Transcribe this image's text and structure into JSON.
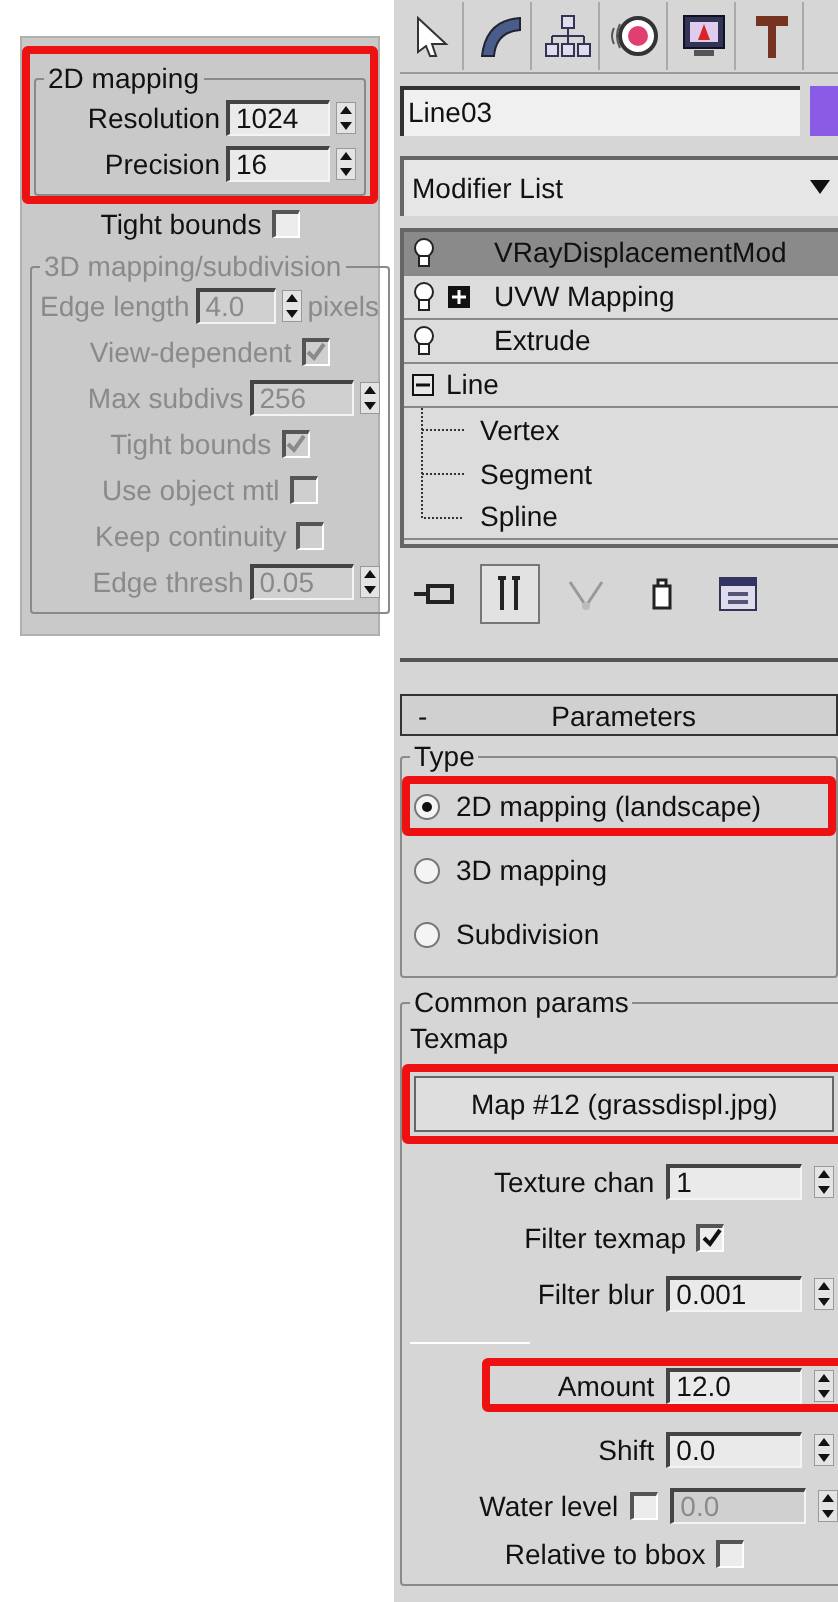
{
  "left_panel": {
    "group_2d": {
      "title": "2D mapping",
      "highlighted": true,
      "rows": [
        {
          "label": "Resolution",
          "value": "1024"
        },
        {
          "label": "Precision",
          "value": "16"
        }
      ]
    },
    "tight_bounds": {
      "label": "Tight bounds",
      "checked": false
    },
    "group_3d": {
      "title": "3D mapping/subdivision",
      "disabled": true,
      "rows": [
        {
          "kind": "spinner",
          "label": "Edge length",
          "value": "4.0",
          "unit": "pixels"
        },
        {
          "kind": "checkbox",
          "label": "View-dependent",
          "checked": true
        },
        {
          "kind": "spinner",
          "label": "Max subdivs",
          "value": "256"
        },
        {
          "kind": "checkbox",
          "label": "Tight bounds",
          "checked": true
        },
        {
          "kind": "checkbox",
          "label": "Use object mtl",
          "checked": false
        },
        {
          "kind": "checkbox",
          "label": "Keep continuity",
          "checked": false
        },
        {
          "kind": "spinner",
          "label": "Edge thresh",
          "value": "0.05"
        }
      ]
    }
  },
  "right_panel": {
    "object_name": "Line03",
    "modifier_list": "Modifier List",
    "stack": [
      {
        "name": "VRayDisplacementMod",
        "kind": "modifier",
        "selected": true
      },
      {
        "name": "UVW Mapping",
        "kind": "modifier",
        "selected": false,
        "expanded": false
      },
      {
        "name": "Extrude",
        "kind": "modifier",
        "selected": false
      },
      {
        "name": "Line",
        "kind": "object",
        "selected": false,
        "expanded": true,
        "children": [
          {
            "name": "Vertex"
          },
          {
            "name": "Segment"
          },
          {
            "name": "Spline"
          }
        ]
      }
    ],
    "stack_tools": [
      {
        "kind": "pin",
        "pressed": false
      },
      {
        "kind": "end_result",
        "pressed": true
      },
      {
        "kind": "unique",
        "pressed": false
      },
      {
        "kind": "remove",
        "pressed": false
      },
      {
        "kind": "configure",
        "pressed": false
      }
    ],
    "rollout": {
      "toggle": "-",
      "title": "Parameters"
    },
    "type_group": {
      "title": "Type",
      "options": [
        {
          "label": "2D mapping (landscape)",
          "selected": true,
          "highlighted": true
        },
        {
          "label": "3D mapping",
          "selected": false,
          "highlighted": false
        },
        {
          "label": "Subdivision",
          "selected": false,
          "highlighted": false
        }
      ]
    },
    "common_group": {
      "title": "Common params",
      "texmap_label": "Texmap",
      "map_button": {
        "label": "Map #12 (grassdispl.jpg)",
        "highlighted": true
      },
      "rows": [
        {
          "kind": "spinner",
          "label": "Texture chan",
          "value": "1",
          "highlighted": false
        },
        {
          "kind": "checkbox",
          "label": "Filter texmap",
          "checked": true
        },
        {
          "kind": "spinner",
          "label": "Filter blur",
          "value": "0.001",
          "highlighted": false
        },
        {
          "kind": "separator"
        },
        {
          "kind": "spinner",
          "label": "Amount",
          "value": "12.0",
          "highlighted": true
        },
        {
          "kind": "spinner",
          "label": "Shift",
          "value": "0.0",
          "highlighted": false
        },
        {
          "kind": "check_spinner",
          "label": "Water level",
          "checked": false,
          "value": "0.0"
        },
        {
          "kind": "checkbox",
          "label": "Relative to bbox",
          "checked": false
        }
      ]
    }
  }
}
